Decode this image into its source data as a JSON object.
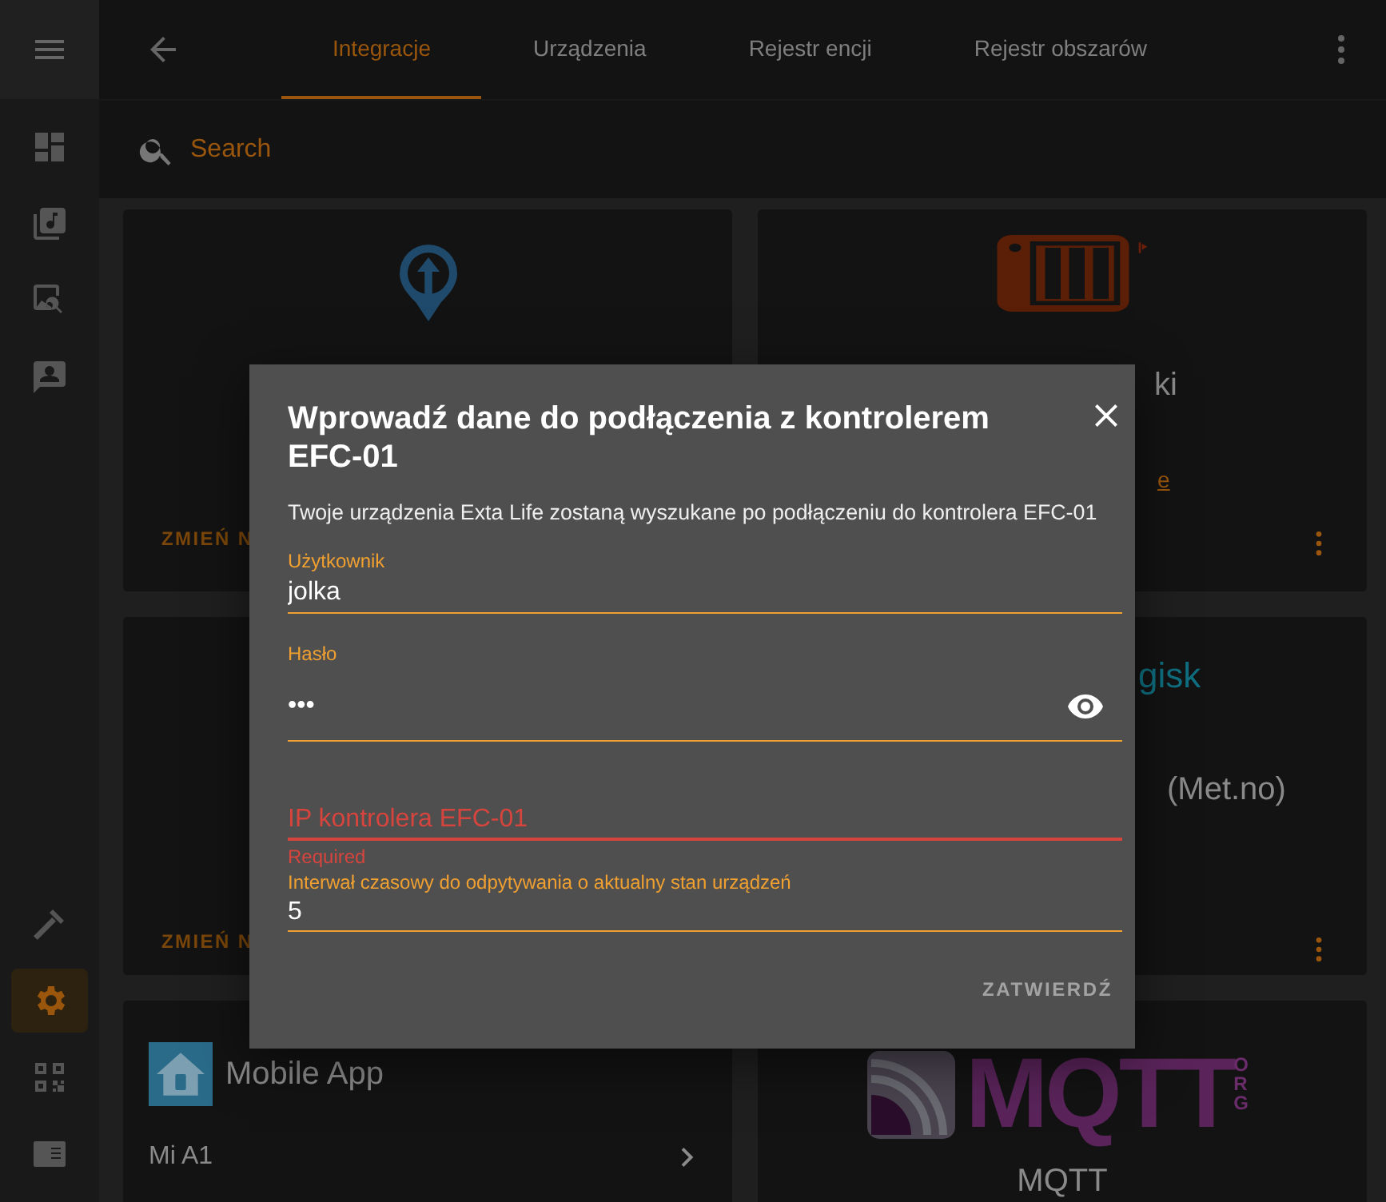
{
  "sidebar": {
    "items": [
      {
        "kind": "dashboard",
        "selected": false
      },
      {
        "kind": "media",
        "selected": false
      },
      {
        "kind": "gallery",
        "selected": false
      },
      {
        "kind": "feedback",
        "selected": false
      }
    ],
    "bottom_items": [
      {
        "kind": "hammer",
        "selected": false
      },
      {
        "kind": "gear",
        "selected": true
      },
      {
        "kind": "qr",
        "selected": false
      },
      {
        "kind": "panel",
        "selected": false
      }
    ]
  },
  "tabs": [
    {
      "label": "Integracje",
      "selected": true
    },
    {
      "label": "Urządzenia",
      "selected": false
    },
    {
      "label": "Rejestr encji",
      "selected": false
    },
    {
      "label": "Rejestr obszarów",
      "selected": false
    }
  ],
  "search": {
    "placeholder": "Search"
  },
  "cards": [
    {
      "kind": "location",
      "action": "ZMIEŃ N"
    },
    {
      "kind": "nas",
      "title": "ki",
      "link": "e"
    },
    {
      "kind": "blank",
      "action": "ZMIEŃ N"
    },
    {
      "kind": "weather",
      "brand": "gisk",
      "title": "(Met.no)"
    },
    {
      "kind": "mobile",
      "title": "Mobile App",
      "row": "Mi A1"
    },
    {
      "kind": "mqtt",
      "logo_text": "MQTT",
      "logo_suffix": "ORG",
      "title": "MQTT"
    }
  ],
  "dialog": {
    "title": "Wprowadź dane do podłączenia z kontrolerem EFC-01",
    "description": "Twoje urządzenia Exta Life zostaną wyszukane po podłączeniu do kontrolera EFC-01",
    "fields": [
      {
        "kind": "text",
        "label": "Użytkownik",
        "value": "jolka",
        "invalid": false
      },
      {
        "kind": "password",
        "label": "Hasło",
        "value": "•••",
        "invalid": false
      },
      {
        "kind": "text",
        "placeholder": "IP kontrolera EFC-01",
        "invalid": true,
        "error": "Required"
      },
      {
        "kind": "text",
        "label": "Interwał czasowy do odpytywania o aktualny stan urządzeń",
        "value": "5",
        "invalid": false
      }
    ],
    "submit": "ZATWIERDŹ"
  }
}
